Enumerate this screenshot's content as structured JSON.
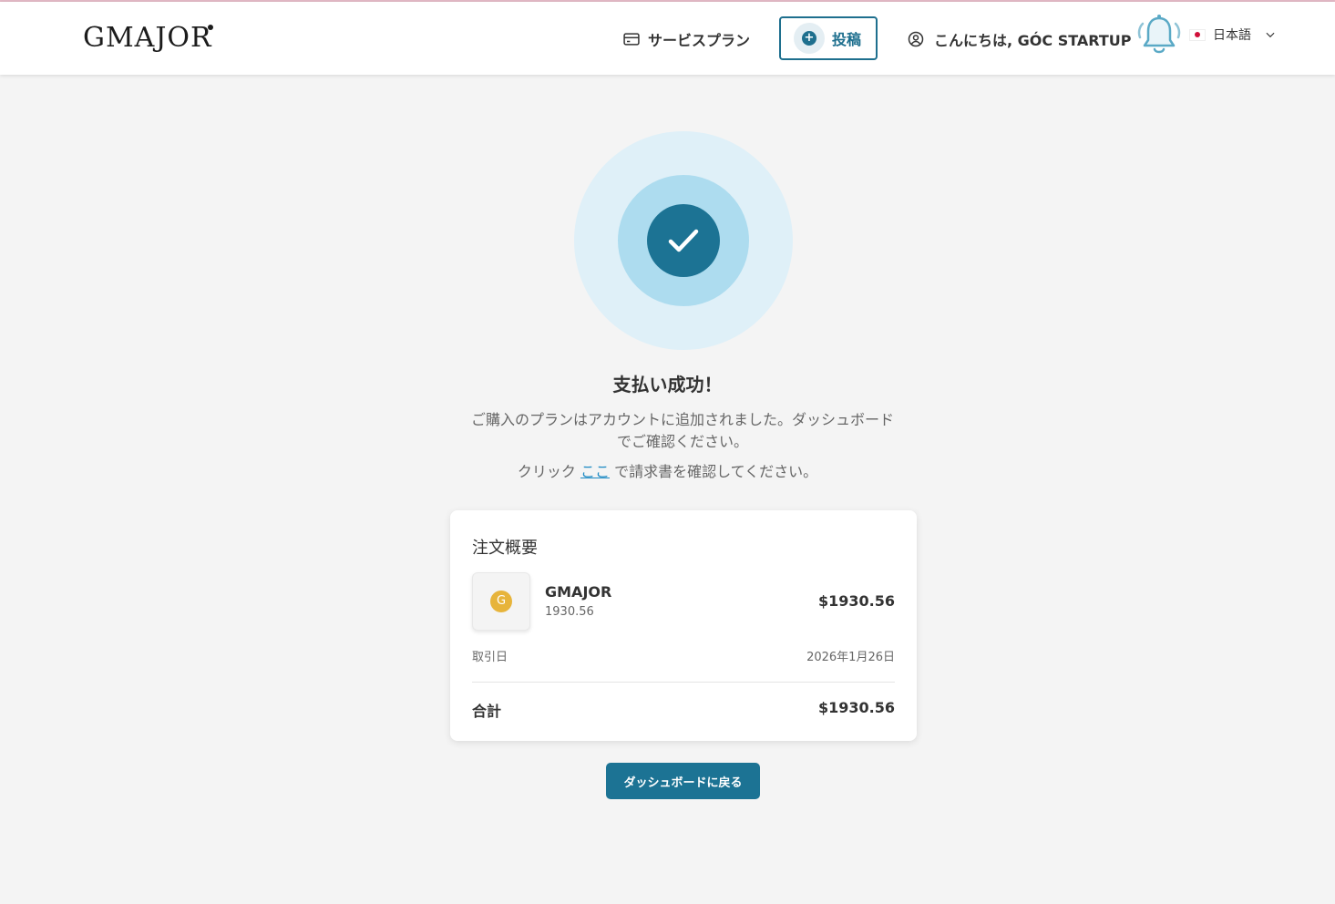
{
  "header": {
    "logo": "GMAJOR",
    "service_plan": "サービスプラン",
    "post": "投稿",
    "greeting": "こんにちは, GÓC STARTUP",
    "language": "日本語"
  },
  "success": {
    "title": "支払い成功！",
    "description": "ご購入のプランはアカウントに追加されました。ダッシュボードでご確認ください。",
    "invoice_prefix": "クリック",
    "invoice_link": "ここ",
    "invoice_suffix": "で請求書を確認してください。"
  },
  "order": {
    "title": "注文概要",
    "item_initial": "G",
    "item_name": "GMAJOR",
    "item_sub": "1930.56",
    "item_price": "$1930.56",
    "date_label": "取引日",
    "date_value": "2026年1月26日",
    "total_label": "合計",
    "total_value": "$1930.56"
  },
  "actions": {
    "back_dashboard": "ダッシュボードに戻る"
  },
  "colors": {
    "primary": "#1c7394",
    "accent_link": "#1f8bc4",
    "success_outer": "#dff0f8",
    "success_mid": "#addcef"
  }
}
